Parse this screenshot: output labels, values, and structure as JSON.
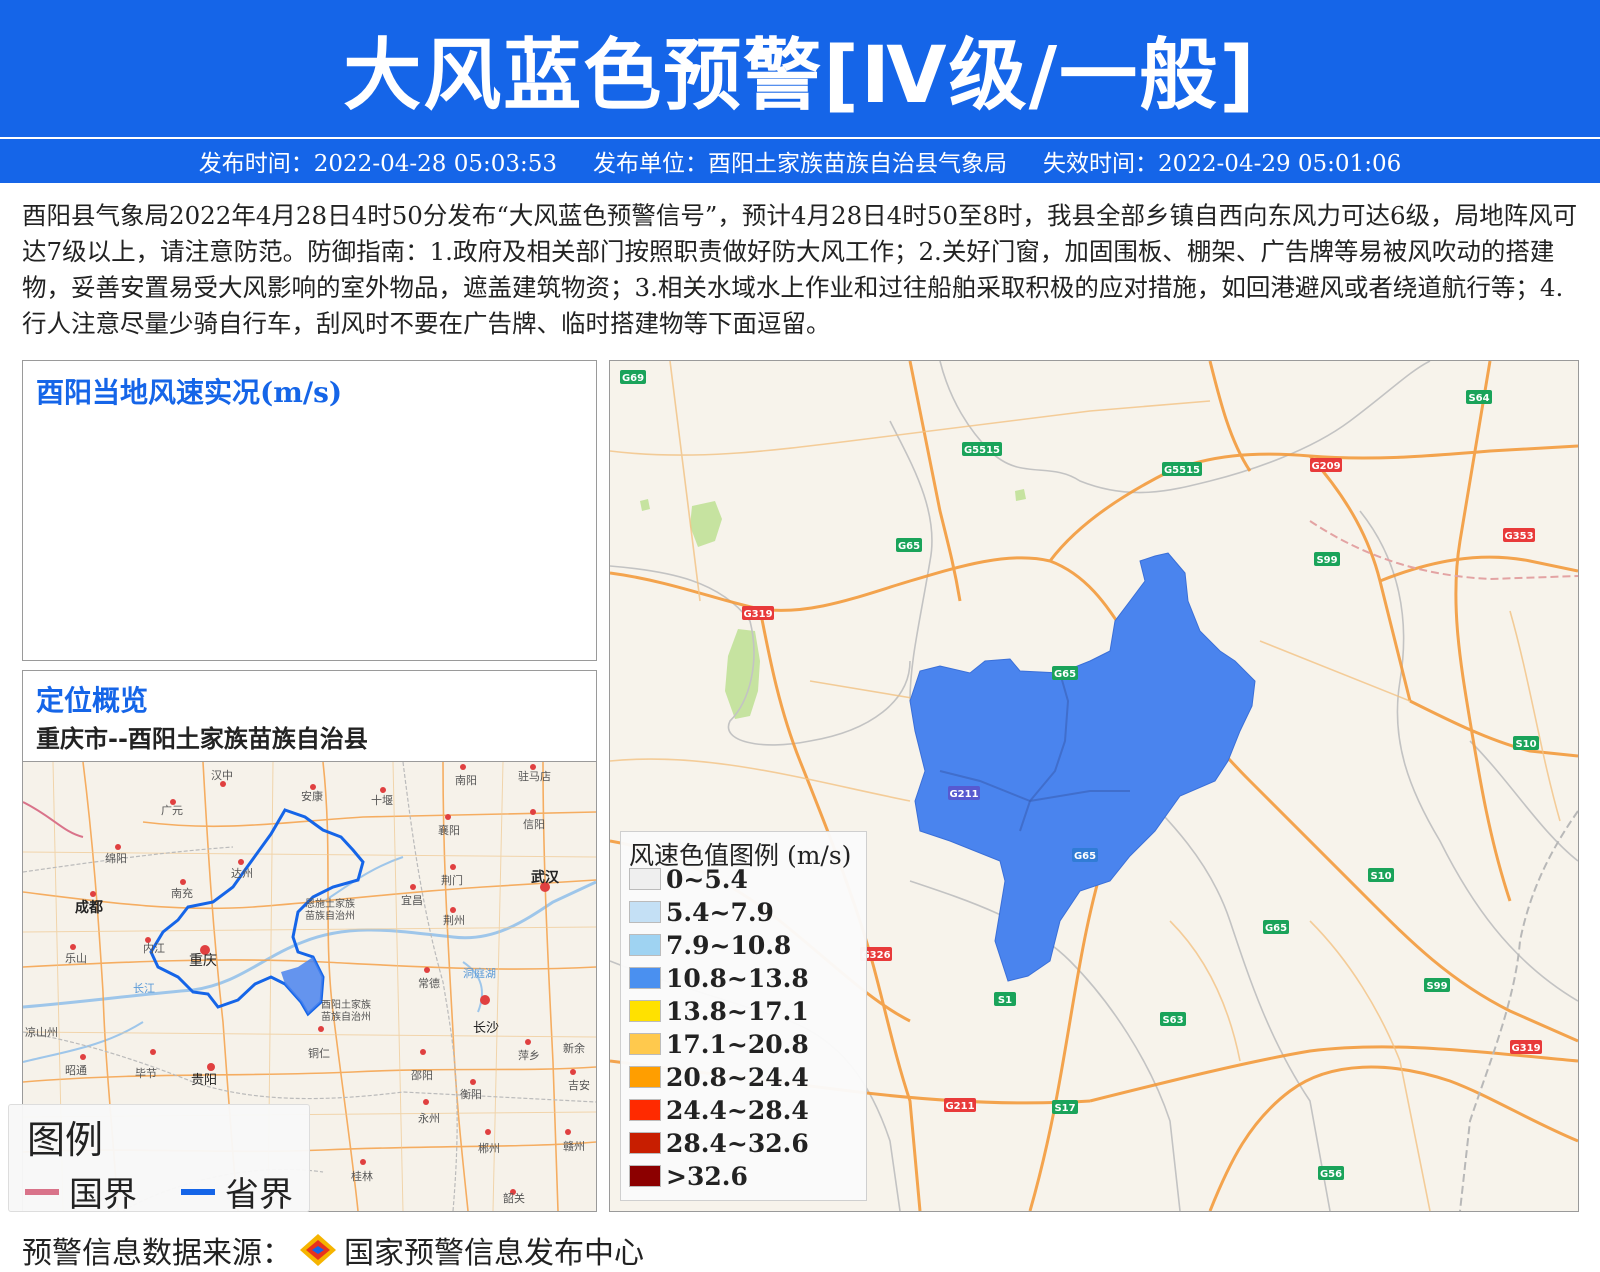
{
  "header": {
    "title": "大风蓝色预警[Ⅳ级/一般]",
    "publish_time": "发布时间：2022-04-28 05:03:53",
    "publisher": "发布单位：酉阳土家族苗族自治县气象局",
    "expire_time": "失效时间：2022-04-29 05:01:06"
  },
  "description": "酉阳县气象局2022年4月28日4时50分发布“大风蓝色预警信号”，预计4月28日4时50至8时，我县全部乡镇自西向东风力可达6级，局地阵风可达7级以上，请注意防范。防御指南：1.政府及相关部门按照职责做好防大风工作；2.关好门窗，加固围板、棚架、广告牌等易被风吹动的搭建物，妥善安置易受大风影响的室外物品，遮盖建筑物资；3.相关水域水上作业和过往船舶采取积极的应对措施，如回港避风或者绕道航行等；4.行人注意尽量少骑自行车，刮风时不要在广告牌、临时搭建物等下面逗留。",
  "wind_panel": {
    "title": "酉阳当地风速实况(m/s)"
  },
  "location_panel": {
    "title": "定位概览",
    "subtitle": "重庆市--酉阳土家族苗族自治县",
    "legend": {
      "title": "图例",
      "national": "国界",
      "provincial": "省界",
      "national_color": "#d9738a",
      "provincial_color": "#1565e8"
    },
    "cities": [
      "汉中",
      "安康",
      "十堰",
      "南阳",
      "驻马店",
      "广元",
      "襄阳",
      "信阳",
      "绵阳",
      "达州",
      "荆门",
      "南充",
      "武汉",
      "成都",
      "宜昌",
      "荆州",
      "恩施土家族",
      "苗族自治州",
      "内江",
      "乐山",
      "重庆",
      "长江",
      "常德",
      "洞庭湖",
      "酉阳土家族",
      "苗族自治州",
      "长沙",
      "铜仁",
      "萍乡",
      "新余",
      "昭通",
      "毕节",
      "贵阳",
      "邵阳",
      "衡阳",
      "吉安",
      "永州",
      "郴州",
      "赣州",
      "桂林",
      "韶关",
      "凉山州"
    ]
  },
  "main_map": {
    "highlight_color": "#4a84ee",
    "road_labels": [
      "G69",
      "G5515",
      "G5515",
      "S64",
      "G209",
      "G353",
      "G65",
      "S99",
      "G319",
      "G65",
      "S10",
      "G211",
      "G65",
      "S10",
      "G65",
      "S99",
      "G326",
      "S1",
      "S63",
      "G319",
      "G211",
      "S17",
      "G56"
    ],
    "legend": {
      "title": "风速色值图例 (m/s)",
      "items": [
        {
          "label": "0~5.4",
          "color": "#efefef"
        },
        {
          "label": "5.4~7.9",
          "color": "#c4e0f5"
        },
        {
          "label": "7.9~10.8",
          "color": "#9fd3f2"
        },
        {
          "label": "10.8~13.8",
          "color": "#4a90f0"
        },
        {
          "label": "13.8~17.1",
          "color": "#ffe100"
        },
        {
          "label": "17.1~20.8",
          "color": "#ffc94d"
        },
        {
          "label": "20.8~24.4",
          "color": "#ff9e00"
        },
        {
          "label": "24.4~28.4",
          "color": "#ff2a00"
        },
        {
          "label": "28.4~32.6",
          "color": "#c81e00"
        },
        {
          "label": ">32.6",
          "color": "#8c0000"
        }
      ]
    }
  },
  "footer": {
    "source": "预警信息数据来源：",
    "org": "国家预警信息发布中心"
  }
}
